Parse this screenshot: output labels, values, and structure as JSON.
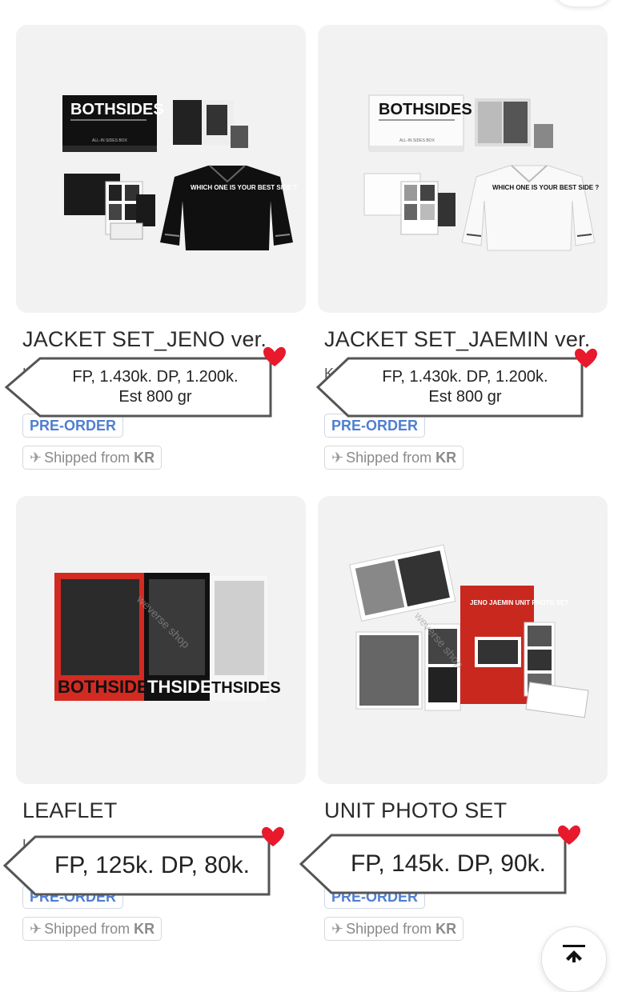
{
  "products": [
    {
      "title": "JACKET SET_JENO ver.",
      "stub": "K",
      "badge": "PRE-ORDER",
      "ship_prefix": "Shipped from ",
      "ship_country": "KR",
      "price_line1": "FP, 1.430k. DP, 1.200k.",
      "price_line2": "Est 800 gr",
      "image": {
        "box_title": "BOTHSIDES",
        "box_label": "ALL-IN SIDES BOX",
        "jacket_text": "WHICH ONE IS YOUR BEST SIDE ?",
        "variant": "black"
      }
    },
    {
      "title": "JACKET SET_JAEMIN ver.",
      "stub": "K",
      "badge": "PRE-ORDER",
      "ship_prefix": "Shipped from ",
      "ship_country": "KR",
      "price_line1": "FP, 1.430k. DP, 1.200k.",
      "price_line2": "Est 800 gr",
      "image": {
        "box_title": "BOTHSIDES",
        "box_label": "ALL-IN SIDES BOX",
        "jacket_text": "WHICH ONE IS YOUR BEST SIDE ?",
        "variant": "white"
      }
    },
    {
      "title": "LEAFLET",
      "stub": "L",
      "badge": "PRE-ORDER",
      "ship_prefix": "Shipped from ",
      "ship_country": "KR",
      "price_line1": "FP, 125k. DP, 80k.",
      "image": {
        "poster_text": [
          "BOTHSIDES",
          "THSIDES",
          "THSIDES"
        ],
        "watermark": "weverse shop"
      }
    },
    {
      "title": "UNIT PHOTO SET",
      "stub": "",
      "badge": "PRE-ORDER",
      "ship_prefix": "Shipped from ",
      "ship_country": "KR",
      "price_line1": "FP, 145k. DP, 90k.",
      "image": {
        "envelope_title": "JENO JAEMIN UNIT PHOTO SET",
        "watermark": "weverse shop"
      }
    }
  ],
  "icons": {
    "heart": "heart-icon",
    "plane": "airplane-icon",
    "scroll_top": "arrow-up-to-line-icon"
  },
  "colors": {
    "badge_blue": "#4f7fd0",
    "heart_red": "#e8192c",
    "thumb_bg": "#f2f2f2"
  }
}
